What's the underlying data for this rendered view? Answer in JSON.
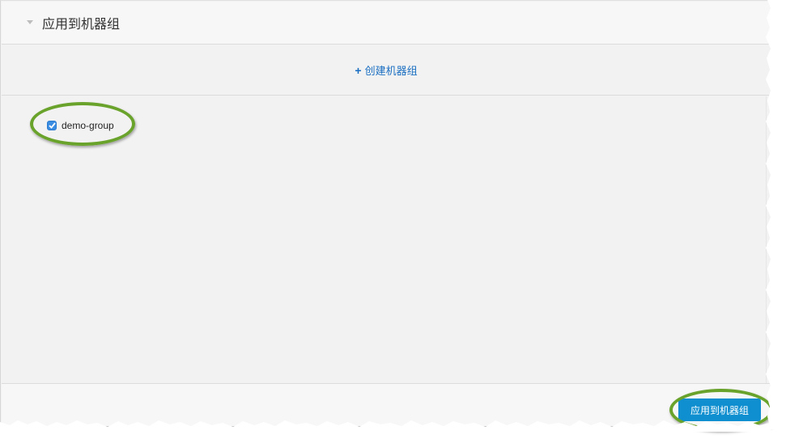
{
  "header": {
    "title": "应用到机器组",
    "collapse_icon": "triangle-down-icon"
  },
  "create_bar": {
    "plus": "+",
    "label": "创建机器组"
  },
  "groups": [
    {
      "label": "demo-group",
      "checked": true
    }
  ],
  "footer": {
    "apply_label": "应用到机器组"
  },
  "colors": {
    "link": "#1b6fc2",
    "button": "#0f8fd0",
    "checkbox": "#3b8de2",
    "highlight": "#6aa32c"
  }
}
